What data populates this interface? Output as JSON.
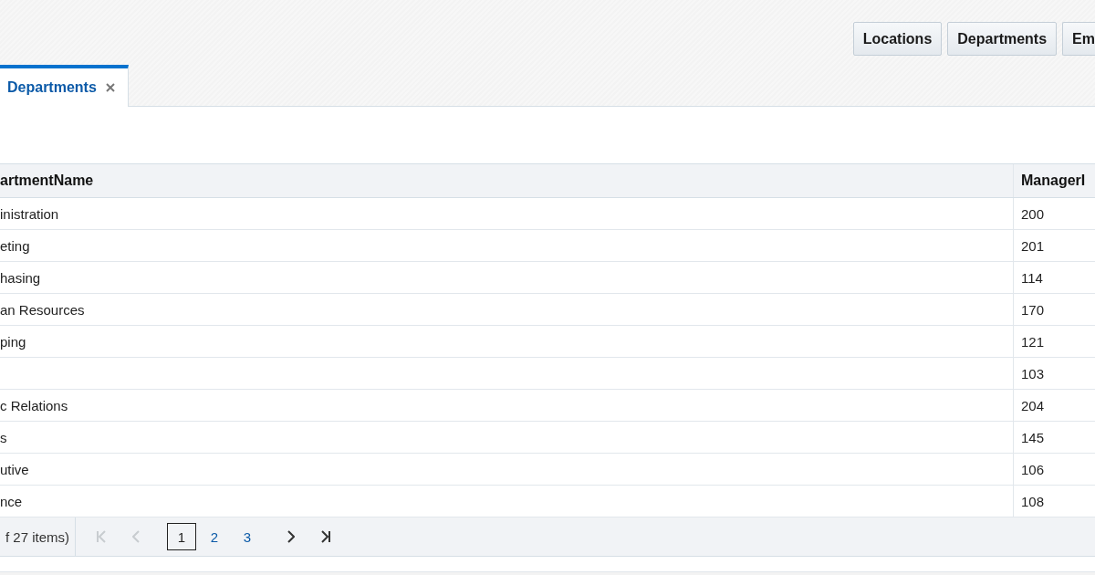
{
  "toolbar": {
    "buttons": [
      "Locations",
      "Departments",
      "Em"
    ]
  },
  "tabs": [
    {
      "label": "Departments",
      "selected": true
    }
  ],
  "table": {
    "columns": [
      "artmentName",
      "ManagerI"
    ],
    "rows": [
      [
        "inistration",
        "200"
      ],
      [
        "eting",
        "201"
      ],
      [
        "hasing",
        "114"
      ],
      [
        "an Resources",
        "170"
      ],
      [
        "ping",
        "121"
      ],
      [
        "",
        "103"
      ],
      [
        "c Relations",
        "204"
      ],
      [
        "s",
        "145"
      ],
      [
        "utive",
        "106"
      ],
      [
        "nce",
        "108"
      ]
    ]
  },
  "pager": {
    "summary": "f 27 items)",
    "first_disabled": true,
    "prev_disabled": true,
    "next_disabled": false,
    "last_disabled": false,
    "pages": [
      {
        "label": "1",
        "selected": true
      },
      {
        "label": "2",
        "selected": false
      },
      {
        "label": "3",
        "selected": false
      }
    ]
  }
}
